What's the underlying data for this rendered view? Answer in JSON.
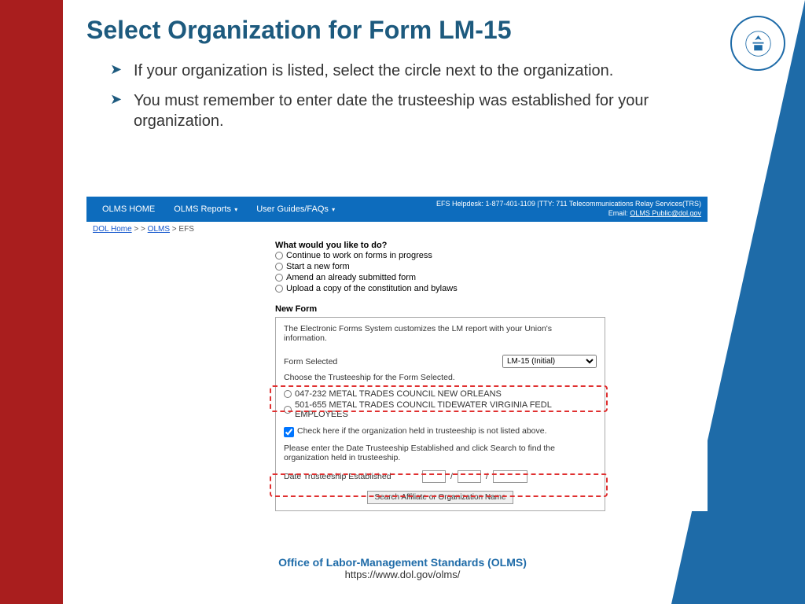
{
  "slide": {
    "title": "Select Organization for Form LM-15",
    "bullets": [
      "If your organization is listed, select the circle next to the organization.",
      "You must remember to enter date the trusteeship was established for your organization."
    ]
  },
  "nav": {
    "home": "OLMS HOME",
    "reports": "OLMS Reports",
    "guides": "User Guides/FAQs",
    "helpdesk": "EFS Helpdesk: 1-877-401-1109 |TTY: 711 Telecommunications Relay Services(TRS)",
    "email_label": "Email:",
    "email": "OLMS Public@dol.gov"
  },
  "breadcrumb": {
    "dol": "DOL Home",
    "olms": "OLMS",
    "efs": "EFS",
    "sep": " > > "
  },
  "question": {
    "title": "What would you like to do?",
    "opts": [
      "Continue to work on forms in progress",
      "Start a new form",
      "Amend an already submitted form",
      "Upload a copy of the constitution and bylaws"
    ]
  },
  "form": {
    "new_form_label": "New Form",
    "intro": "The Electronic Forms System customizes the LM report with your Union's information.",
    "form_selected_label": "Form Selected",
    "form_selected_value": "LM-15 (Initial)",
    "choose_trusteeship": "Choose the Trusteeship for the Form Selected.",
    "orgs": [
      "047-232 METAL TRADES COUNCIL NEW ORLEANS",
      "501-655 METAL TRADES COUNCIL TIDEWATER VIRGINIA FEDL EMPLOYEES"
    ],
    "check_label": "Check here if the organization held in trusteeship is not listed above.",
    "please_enter": "Please enter the Date Trusteeship Established and click Search to find the organization held in trusteeship.",
    "date_label": "Date Trusteeship Established",
    "slash": "/",
    "search_btn": "Search Affiliate or Organization Name"
  },
  "footer": {
    "line1": "Office of Labor-Management Standards (OLMS)",
    "line2": "https://www.dol.gov/olms/"
  }
}
